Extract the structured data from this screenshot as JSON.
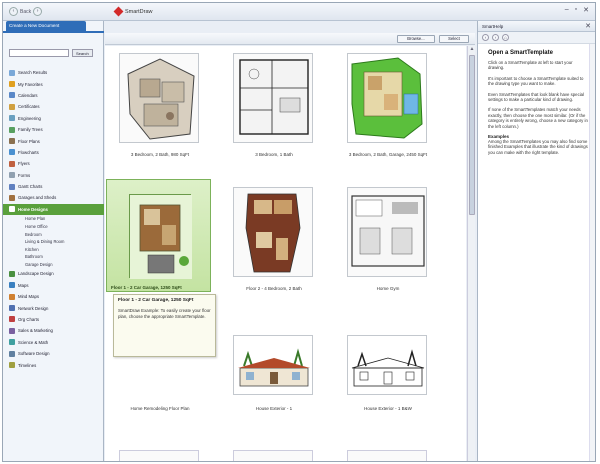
{
  "titlebar": {
    "back_label": "Back",
    "app_name": "SmartDraw",
    "controls": [
      "–",
      "▫",
      "✕"
    ]
  },
  "left": {
    "tab": "Create a New Document",
    "search_button": "Search",
    "search_placeholder": "",
    "categories": [
      {
        "label": "Search Results",
        "color": "#7aa8d8"
      },
      {
        "label": "My Favorites",
        "color": "#e0a020"
      },
      {
        "label": "Calendars",
        "color": "#5a88c8"
      },
      {
        "label": "Certificates",
        "color": "#d0a040"
      },
      {
        "label": "Engineering",
        "color": "#6aa0c0"
      },
      {
        "label": "Family Trees",
        "color": "#58a060"
      },
      {
        "label": "Floor Plans",
        "color": "#8a7050"
      },
      {
        "label": "Flowcharts",
        "color": "#4a90d0"
      },
      {
        "label": "Flyers",
        "color": "#c06040"
      },
      {
        "label": "Forms",
        "color": "#90a0b0"
      },
      {
        "label": "Gantt Charts",
        "color": "#6080c0"
      },
      {
        "label": "Garages and Sheds",
        "color": "#a07040"
      },
      {
        "label": "Home Designs",
        "color": "#ffffff",
        "selected": true
      }
    ],
    "subcategories": [
      "Home Plan",
      "Home Office",
      "Bedroom",
      "Living & Dining Room",
      "Kitchen",
      "Bathroom",
      "Garage Design"
    ],
    "categories_after": [
      {
        "label": "Landscape Design",
        "color": "#4a9040"
      },
      {
        "label": "Maps",
        "color": "#3a80c0"
      },
      {
        "label": "Mind Maps",
        "color": "#d08030"
      },
      {
        "label": "Network Design",
        "color": "#5070b0"
      },
      {
        "label": "Org Charts",
        "color": "#c04040"
      },
      {
        "label": "Sales & Marketing",
        "color": "#7a60a0"
      },
      {
        "label": "Science & Math",
        "color": "#40a0a0"
      },
      {
        "label": "Software Design",
        "color": "#6080a0"
      },
      {
        "label": "Timelines",
        "color": "#a0a040"
      }
    ]
  },
  "toolbar": {
    "browse_label": "Browse...",
    "select_label": "Select"
  },
  "gallery": {
    "items": [
      "3 Bedroom, 2 Bath, 980 SqFt",
      "3 Bedroom, 1 Bath",
      "3 Bedroom, 2 Bath, Garage, 2450 SqFt",
      "Floor 1 - 2 Car Garage, 1250 SqFt",
      "Floor 2 - 4 Bedroom, 2 Bath",
      "Home Gym",
      "Home Remodeling Floor Plan",
      "House Exterior - 1",
      "House Exterior - 1 B&W"
    ]
  },
  "tooltip": {
    "title": "Floor 1 - 2 Car Garage, 1250 SqFt",
    "body": "SmartDraw Example: To easily create your floor plan, choose the appropriate SmartTemplate."
  },
  "help": {
    "header": "SmartHelp",
    "heading": "Open a SmartTemplate",
    "p1": "Click on a SmartTemplate at left to start your drawing.",
    "p2": "It's important to choose a SmartTemplate suited to the drawing type you want to make.",
    "p3": "Even SmartTemplates that look blank have special settings to make a particular kind of drawing.",
    "p4": "If none of the SmartTemplates match your needs exactly, then choose the one most similar. (Or if the category is entirely wrong, choose a new category in the left column.)",
    "examples_title": "Examples",
    "p5": "Among the SmartTemplates you may also find some finished Examples that illustrate the kind of drawings you can make with the right template."
  }
}
